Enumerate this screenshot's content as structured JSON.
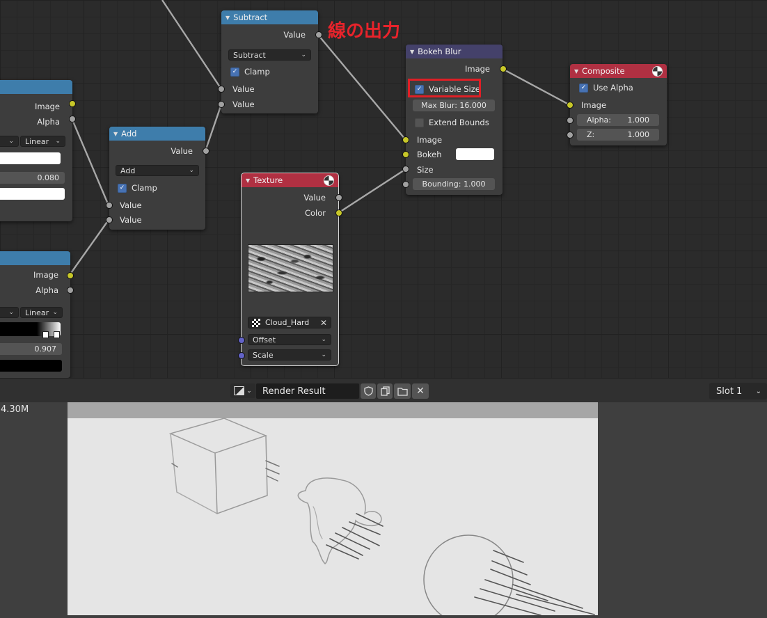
{
  "annotation": "線の出力",
  "nodes": {
    "left_top": {
      "out1": "Image",
      "out2": "Alpha",
      "interp": "Linear",
      "value": "0.080"
    },
    "left_bottom": {
      "out1": "Image",
      "out2": "Alpha",
      "interp": "Linear",
      "value": "0.907"
    },
    "add": {
      "title": "Add",
      "out": "Value",
      "op": "Add",
      "clamp": "Clamp",
      "in1": "Value",
      "in2": "Value"
    },
    "subtract": {
      "title": "Subtract",
      "out": "Value",
      "op": "Subtract",
      "clamp": "Clamp",
      "in1": "Value",
      "in2": "Value"
    },
    "texture": {
      "title": "Texture",
      "out1": "Value",
      "out2": "Color",
      "tex_name": "Cloud_Hard",
      "in1": "Offset",
      "in2": "Scale"
    },
    "bokeh": {
      "title": "Bokeh Blur",
      "out": "Image",
      "variable_size": "Variable Size",
      "max_blur": "Max Blur: 16.000",
      "extend_bounds": "Extend Bounds",
      "in1": "Image",
      "in2": "Bokeh",
      "in3": "Size",
      "bounding": "Bounding: 1.000"
    },
    "composite": {
      "title": "Composite",
      "use_alpha": "Use Alpha",
      "in1": "Image",
      "alpha_label": "Alpha:",
      "alpha_value": "1.000",
      "z_label": "Z:",
      "z_value": "1.000"
    }
  },
  "viewer": {
    "image_name": "Render Result",
    "slot": "Slot 1",
    "mem": "4.30M"
  }
}
